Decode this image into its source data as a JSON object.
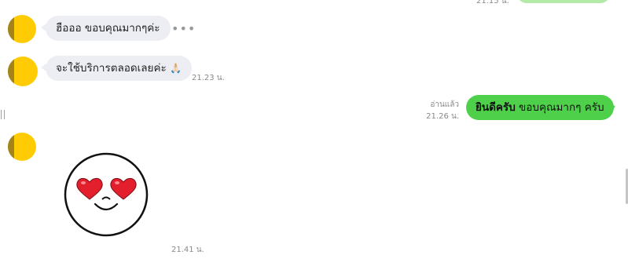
{
  "top_partial": {
    "time": "21.15 น."
  },
  "messages": [
    {
      "text": "ฮือออ ขอบคุณมากๆค่ะ",
      "more": "•••"
    },
    {
      "text": "จะใช้บริการตลอดเลยค่ะ",
      "emoji": "🙏🏻",
      "time": "21.23 น."
    },
    {
      "read": "อ่านแล้ว",
      "time": "21.26 น.",
      "bold": "ยินดีครับ",
      "text": " ขอบคุณมากๆ ครับ"
    },
    {
      "sticker": "heart-eyes-smiley-sticker",
      "time": "21.41 น."
    }
  ],
  "colors": {
    "incoming_bubble": "#eceef3",
    "outgoing_bubble": "#4fd04a",
    "avatar": "#ffcb05"
  }
}
